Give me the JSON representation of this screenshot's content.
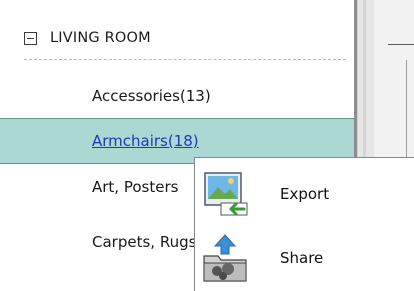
{
  "tree": {
    "category": {
      "label": "LIVING ROOM",
      "state": "expanded"
    },
    "items": [
      {
        "label": "Accessories(13)",
        "selected": false
      },
      {
        "label": "Armchairs(18)",
        "selected": true
      },
      {
        "label": "Art, Posters",
        "selected": false
      },
      {
        "label": "Carpets, Rugs",
        "selected": false
      }
    ]
  },
  "context_menu": {
    "items": [
      {
        "label": "Export",
        "icon": "export-image-icon"
      },
      {
        "label": "Share",
        "icon": "share-folder-icon"
      }
    ]
  },
  "colors": {
    "selected_row": "#acd8d3",
    "selected_text": "#1a3bb8"
  }
}
